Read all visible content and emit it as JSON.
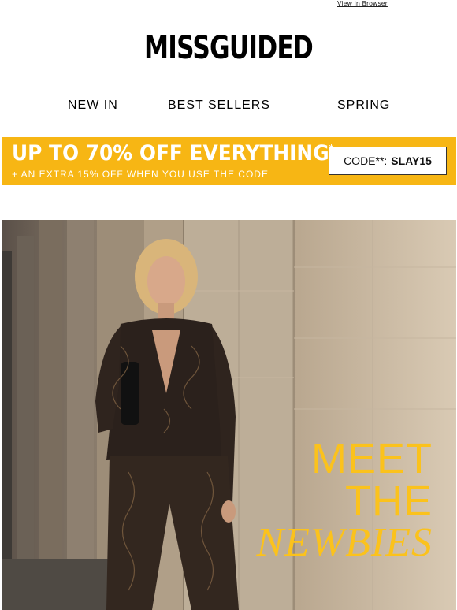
{
  "header": {
    "view_in_browser": "View In Browser",
    "logo": "MISSGUIDED"
  },
  "nav": {
    "items": [
      {
        "label": "NEW IN"
      },
      {
        "label": "BEST SELLERS"
      },
      {
        "label": "SPRING"
      }
    ]
  },
  "promo": {
    "title": "UP TO 70% OFF EVERYTHING",
    "title_mark": "*",
    "subtitle": "+ AN EXTRA 15% OFF WHEN YOU USE THE CODE",
    "code_label": "CODE**:",
    "code": "SLAY15",
    "background_color": "#f7b614"
  },
  "hero": {
    "headline_line1": "MEET",
    "headline_line2": "THE",
    "headline_line3": "NEWBIES",
    "headline_color": "#fbc21c"
  }
}
